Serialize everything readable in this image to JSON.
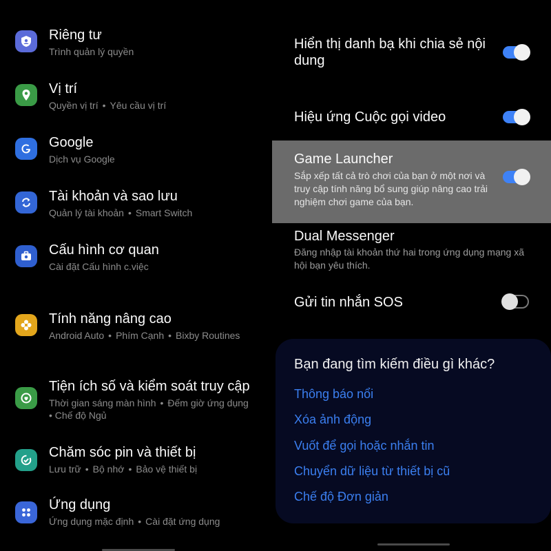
{
  "left_menu": [
    {
      "title": "Riêng tư",
      "subtitle": [
        "Trình quản lý quyền"
      ],
      "icon": "privacy-shield-icon",
      "color": "#5b6bd9"
    },
    {
      "title": "Vị trí",
      "subtitle": [
        "Quyền vị trí",
        "Yêu cầu vị trí"
      ],
      "icon": "location-pin-icon",
      "color": "#3a9b46"
    },
    {
      "title": "Google",
      "subtitle": [
        "Dịch vụ Google"
      ],
      "icon": "google-icon",
      "color": "#2f6fe0"
    },
    {
      "title": "Tài khoản và sao lưu",
      "subtitle": [
        "Quản lý tài khoản",
        "Smart Switch"
      ],
      "icon": "sync-icon",
      "color": "#3366d6"
    },
    {
      "title": "Cấu hình cơ quan",
      "subtitle": [
        "Cài đặt Cấu hình c.việc"
      ],
      "icon": "briefcase-icon",
      "color": "#2f5fcf"
    },
    {
      "title": "Tính năng nâng cao",
      "subtitle": [
        "Android Auto",
        "Phím Cạnh",
        "Bixby Routines"
      ],
      "icon": "gear-plus-icon",
      "color": "#e3a61c"
    },
    {
      "title": "Tiện ích số và kiểm soát truy cập",
      "subtitle": [
        "Thời gian sáng màn hình",
        "Đếm giờ ứng dụng",
        "Chế độ Ngủ"
      ],
      "icon": "wellbeing-icon",
      "color": "#3a9b46"
    },
    {
      "title": "Chăm sóc pin và thiết bị",
      "subtitle": [
        "Lưu trữ",
        "Bộ nhớ",
        "Bảo vệ thiết bị"
      ],
      "icon": "device-care-icon",
      "color": "#23a08a"
    },
    {
      "title": "Ứng dụng",
      "subtitle": [
        "Ứng dụng mặc định",
        "Cài đặt ứng dụng"
      ],
      "icon": "apps-grid-icon",
      "color": "#3a66d8"
    }
  ],
  "settings": [
    {
      "title": "Hiển thị danh bạ khi chia sẻ nội dung",
      "subtitle": "",
      "toggle": "on"
    },
    {
      "title": "Hiệu ứng Cuộc gọi video",
      "subtitle": "",
      "toggle": "on"
    },
    {
      "title": "Game Launcher",
      "subtitle": "Sắp xếp tất cả trò chơi của bạn ở một nơi và truy cập tính năng bổ sung giúp nâng cao trải nghiệm chơi game của bạn.",
      "toggle": "on"
    },
    {
      "title": "Dual Messenger",
      "subtitle": "Đăng nhập tài khoản thứ hai trong ứng dụng mạng xã hội bạn yêu thích.",
      "toggle": null
    },
    {
      "title": "Gửi tin nhắn SOS",
      "subtitle": "",
      "toggle": "off"
    }
  ],
  "suggestions": {
    "question": "Bạn đang tìm kiếm điều gì khác?",
    "links": [
      "Thông báo nổi",
      "Xóa ảnh động",
      "Vuốt để gọi hoặc nhắn tin",
      "Chuyển dữ liệu từ thiết bị cũ",
      "Chế độ Đơn giản"
    ]
  },
  "colors": {
    "accent": "#3e82f7",
    "link": "#3b7ff0",
    "highlight": "#6b6b6b"
  }
}
